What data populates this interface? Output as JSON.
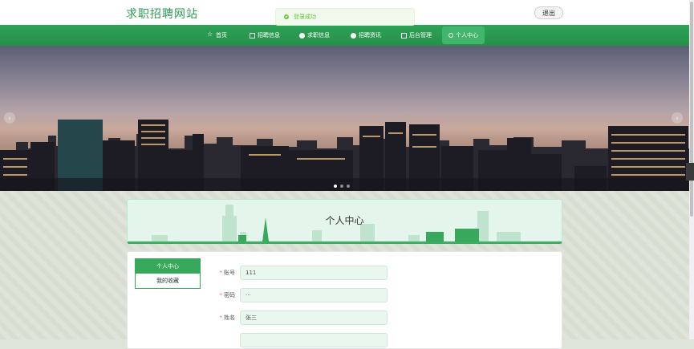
{
  "header": {
    "site_title": "求职招聘网站",
    "logout_label": "退出"
  },
  "toast": {
    "message": "登录成功",
    "icon": "success-check-icon",
    "color": "#67c23a"
  },
  "nav": {
    "items": [
      {
        "label": "首页",
        "icon": "star-icon"
      },
      {
        "label": "招聘信息",
        "icon": "briefcase-icon"
      },
      {
        "label": "求职信息",
        "icon": "info-icon"
      },
      {
        "label": "招聘资讯",
        "icon": "news-icon"
      },
      {
        "label": "后台管理",
        "icon": "dashboard-icon"
      },
      {
        "label": "个人中心",
        "icon": "user-icon",
        "active": true
      }
    ]
  },
  "banner": {
    "prev_label": "‹",
    "next_label": "›",
    "slides": 3,
    "current_slide": 1
  },
  "page": {
    "title": "个人中心"
  },
  "sidebar_menu": {
    "items": [
      {
        "label": "个人中心",
        "active": true
      },
      {
        "label": "我的收藏",
        "active": false
      }
    ]
  },
  "form": {
    "fields": [
      {
        "label": "账号",
        "value": "111",
        "required": true
      },
      {
        "label": "密码",
        "value": "···",
        "required": true
      },
      {
        "label": "姓名",
        "value": "张三",
        "required": true
      }
    ]
  },
  "colors": {
    "brand_green": "#2e9b52",
    "nav_bg": "#2fa257",
    "active_menu": "#37a85c"
  }
}
